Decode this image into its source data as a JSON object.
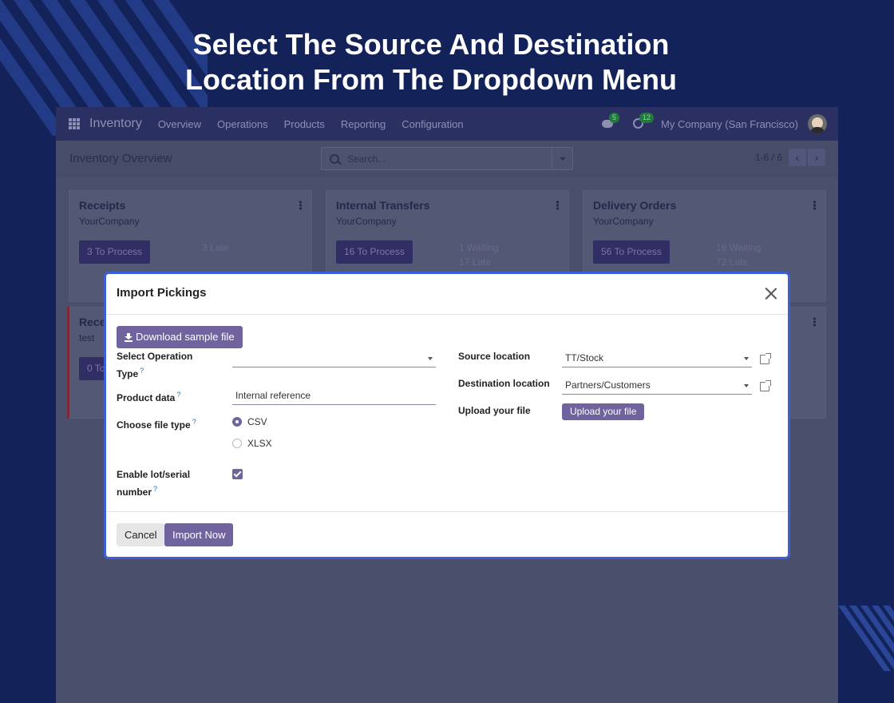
{
  "headline": {
    "line1": "Select The Source And Destination",
    "line2": "Location From The Dropdown Menu"
  },
  "navbar": {
    "brand": "Inventory",
    "menu": [
      "Overview",
      "Operations",
      "Products",
      "Reporting",
      "Configuration"
    ],
    "messages_count": "5",
    "activities_count": "12",
    "company": "My Company (San Francisco)"
  },
  "control": {
    "page_title": "Inventory Overview",
    "search_placeholder": "Search...",
    "pager": "1-6 / 6"
  },
  "cards": [
    {
      "title": "Receipts",
      "company": "YourCompany",
      "button": "3 To Process",
      "stat1": "3 Late",
      "stat2": ""
    },
    {
      "title": "Internal Transfers",
      "company": "YourCompany",
      "button": "16 To Process",
      "stat1": "1 Waiting",
      "stat2": "17 Late"
    },
    {
      "title": "Delivery Orders",
      "company": "YourCompany",
      "button": "56 To Process",
      "stat1": "16 Waiting",
      "stat2": "72 Late"
    }
  ],
  "second_row_card": {
    "title": "Rece",
    "company": "test",
    "button": "0 To"
  },
  "modal": {
    "title": "Import Pickings",
    "download_label": "Download sample file",
    "operation_type_label_1": "Select Operation",
    "operation_type_label_2": "Type",
    "operation_type_value": "",
    "product_data_label": "Product data",
    "product_data_value": "Internal reference",
    "file_type_label": "Choose file type",
    "file_types": [
      "CSV",
      "XLSX"
    ],
    "selected_file_type": "CSV",
    "lot_label_1": "Enable lot/serial",
    "lot_label_2": "number",
    "lot_enabled": true,
    "source_location_label": "Source location",
    "source_location_value": "TT/Stock",
    "destination_location_label": "Destination location",
    "destination_location_value": "Partners/Customers",
    "upload_label": "Upload your file",
    "upload_button": "Upload your file",
    "help_mark": "?",
    "cancel_label": "Cancel",
    "import_label": "Import Now"
  },
  "colors": {
    "background": "#13235a",
    "primary": "#71639e",
    "modal_border": "#3a5fd9"
  }
}
